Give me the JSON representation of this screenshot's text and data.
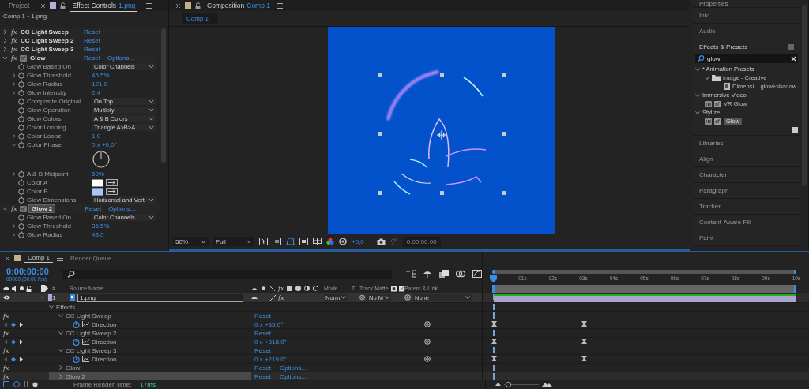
{
  "effect_controls": {
    "tabs": [
      {
        "label": "Project",
        "selected": false
      },
      {
        "label": "Effect Controls",
        "layer": "1.png",
        "selected": true
      }
    ],
    "breadcrumb": "Comp 1 • 1.png",
    "rows": [
      {
        "kind": "effect",
        "fx": "fx",
        "name": "CC Light Sweep",
        "expanded": false,
        "accelerated": false,
        "selected": false,
        "reset": "Reset"
      },
      {
        "kind": "effect",
        "fx": "fx",
        "name": "CC Light Sweep 2",
        "expanded": false,
        "accelerated": false,
        "selected": false,
        "reset": "Reset"
      },
      {
        "kind": "effect",
        "fx": "fx",
        "name": "CC Light Sweep 3",
        "expanded": false,
        "accelerated": false,
        "selected": false,
        "reset": "Reset"
      },
      {
        "kind": "effect",
        "fx": "fx",
        "name": "Glow",
        "expanded": true,
        "accelerated": true,
        "selected": false,
        "reset": "Reset",
        "options": "Options..."
      },
      {
        "kind": "param",
        "label": "Glow Based On",
        "value": {
          "kind": "dropdown",
          "text": "Color Channels"
        }
      },
      {
        "kind": "param",
        "label": "Glow Threshold",
        "expanded": false,
        "value": {
          "kind": "number",
          "text": "45,5%"
        }
      },
      {
        "kind": "param",
        "label": "Glow Radius",
        "expanded": false,
        "value": {
          "kind": "number",
          "text": "121,0"
        }
      },
      {
        "kind": "param",
        "label": "Glow Intensity",
        "expanded": false,
        "value": {
          "kind": "number",
          "text": "2,4"
        }
      },
      {
        "kind": "param",
        "label": "Composite Original",
        "value": {
          "kind": "dropdown",
          "text": "On Top"
        }
      },
      {
        "kind": "param",
        "label": "Glow Operation",
        "value": {
          "kind": "dropdown",
          "text": "Multiply"
        }
      },
      {
        "kind": "param",
        "label": "Glow Colors",
        "value": {
          "kind": "dropdown",
          "text": "A & B Colors"
        }
      },
      {
        "kind": "param",
        "label": "Color Looping",
        "value": {
          "kind": "dropdown",
          "text": "Triangle A>B>A"
        }
      },
      {
        "kind": "param",
        "label": "Color Loops",
        "expanded": false,
        "value": {
          "kind": "number",
          "text": "1,0"
        }
      },
      {
        "kind": "param",
        "label": "Color Phase",
        "expanded": true,
        "value": {
          "kind": "number",
          "text": "0 x +0,0°"
        }
      },
      {
        "kind": "dial"
      },
      {
        "kind": "param",
        "label": "A & B Midpoint",
        "expanded": false,
        "value": {
          "kind": "number",
          "text": "50%"
        }
      },
      {
        "kind": "param",
        "label": "Color A",
        "value": {
          "kind": "color",
          "color": "#ffffff"
        }
      },
      {
        "kind": "param",
        "label": "Color B",
        "value": {
          "kind": "color",
          "color": "#a6c4ff"
        }
      },
      {
        "kind": "param",
        "label": "Glow Dimensions",
        "value": {
          "kind": "dropdown",
          "text": "Horizontal and Vert"
        }
      },
      {
        "kind": "effect",
        "fx": "fx",
        "name": "Glow 2",
        "expanded": true,
        "accelerated": true,
        "selected": true,
        "reset": "Reset",
        "options": "Options..."
      },
      {
        "kind": "param",
        "label": "Glow Based On",
        "value": {
          "kind": "dropdown",
          "text": "Color Channels"
        }
      },
      {
        "kind": "param",
        "label": "Glow Threshold",
        "expanded": false,
        "value": {
          "kind": "number",
          "text": "36,5%"
        }
      },
      {
        "kind": "param",
        "label": "Glow Radius",
        "expanded": false,
        "value": {
          "kind": "number",
          "text": "48,0"
        }
      }
    ]
  },
  "composition": {
    "tab": {
      "label": "Composition",
      "comp": "Comp 1"
    },
    "viewer_tab": "Comp 1",
    "toolbar": {
      "zoom": "50%",
      "resolution": "Full",
      "exposure": "+0,0",
      "timecode": "0:00:00:00"
    }
  },
  "side_panels_top": [
    "Properties",
    "Info",
    "Audio"
  ],
  "effects_presets": {
    "title": "Effects & Presets",
    "search": "glow",
    "tree": [
      {
        "kind": "category",
        "label": "* Animation Presets",
        "expanded": true,
        "selected": false,
        "children": [
          {
            "kind": "folder",
            "label": "Image - Creative",
            "expanded": true,
            "selected": false,
            "children": [
              {
                "kind": "preset",
                "label": "Dimensi... glow+shadow",
                "selected": false
              }
            ]
          }
        ]
      },
      {
        "kind": "category",
        "label": "Immersive Video",
        "expanded": true,
        "selected": false,
        "children": [
          {
            "kind": "effect",
            "label": "VR Glow",
            "selected": false
          }
        ]
      },
      {
        "kind": "category",
        "label": "Stylize",
        "expanded": true,
        "selected": false,
        "children": [
          {
            "kind": "effect",
            "label": "Glow",
            "selected": true
          }
        ]
      }
    ]
  },
  "side_panels_bottom": [
    "Libraries",
    "Align",
    "Character",
    "Paragraph",
    "Tracker",
    "Content-Aware Fill",
    "Paint"
  ],
  "timeline": {
    "tabs": [
      {
        "label": "Comp 1",
        "selected": true
      },
      {
        "label": "Render Queue",
        "selected": false
      }
    ],
    "timecode": "0:00:00:00",
    "frame_info": "00000 (30.00 fps)",
    "columns": {
      "number": "#",
      "source": "Source Name",
      "effects": "fx",
      "mode": "Mode",
      "t": "T",
      "matte": "Track Matte",
      "parent": "Parent & Link"
    },
    "layer": {
      "number": "1",
      "name": "1.png",
      "fx_switch": {
        "label": "fx",
        "on": true
      },
      "mode": "Norm",
      "matte": "No M",
      "parent": "None"
    },
    "rows": [
      {
        "kind": "group",
        "name": "Effects",
        "expanded": true
      },
      {
        "kind": "effect",
        "fx": "fx",
        "name": "CC Light Sweep",
        "expanded": true,
        "selected": false,
        "reset": "Reset"
      },
      {
        "kind": "property",
        "name": "Direction",
        "value": "0 x +35,0°"
      },
      {
        "kind": "effect",
        "fx": "fx",
        "name": "CC Light Sweep 2",
        "expanded": true,
        "selected": false,
        "reset": "Reset"
      },
      {
        "kind": "property",
        "name": "Direction",
        "value": "0 x +318,0°"
      },
      {
        "kind": "effect",
        "fx": "fx",
        "name": "CC Light Sweep 3",
        "expanded": true,
        "selected": false,
        "reset": "Reset"
      },
      {
        "kind": "property",
        "name": "Direction",
        "value": "0 x +219,0°"
      },
      {
        "kind": "effect",
        "fx": "fx",
        "name": "Glow",
        "expanded": false,
        "selected": false,
        "reset": "Reset",
        "options": "Options..."
      },
      {
        "kind": "effect",
        "fx": "fx",
        "name": "Glow 2",
        "expanded": false,
        "selected": true,
        "reset": "Reset",
        "options": "Options..."
      }
    ],
    "ruler": [
      "01s",
      "02s",
      "03s",
      "04s",
      "05s",
      "06s",
      "07s",
      "08s",
      "09s",
      "10s"
    ],
    "zoom_slider": {
      "level": 0.05
    },
    "render_time_label": "Frame Render Time:",
    "render_time": "17ms"
  }
}
